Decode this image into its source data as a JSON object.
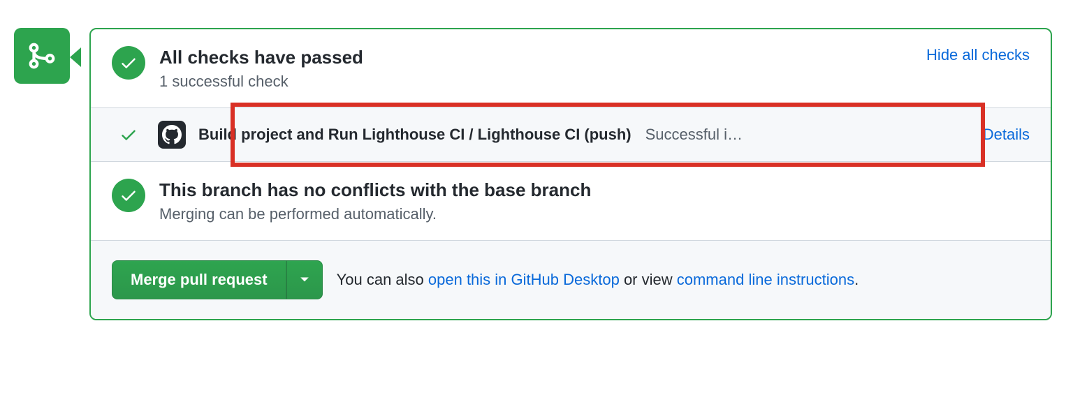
{
  "checks_summary": {
    "title": "All checks have passed",
    "subtitle": "1 successful check",
    "toggle_link": "Hide all checks"
  },
  "check_items": [
    {
      "name": "Build project and Run Lighthouse CI / Lighthouse CI (push)",
      "status_text": "Successful i…",
      "details_link": "Details"
    }
  ],
  "conflicts": {
    "title": "This branch has no conflicts with the base branch",
    "subtitle": "Merging can be performed automatically."
  },
  "merge_footer": {
    "button_label": "Merge pull request",
    "text_prefix": "You can also ",
    "link_desktop": "open this in GitHub Desktop",
    "text_middle": " or view ",
    "link_cli": "command line instructions",
    "text_suffix": "."
  }
}
